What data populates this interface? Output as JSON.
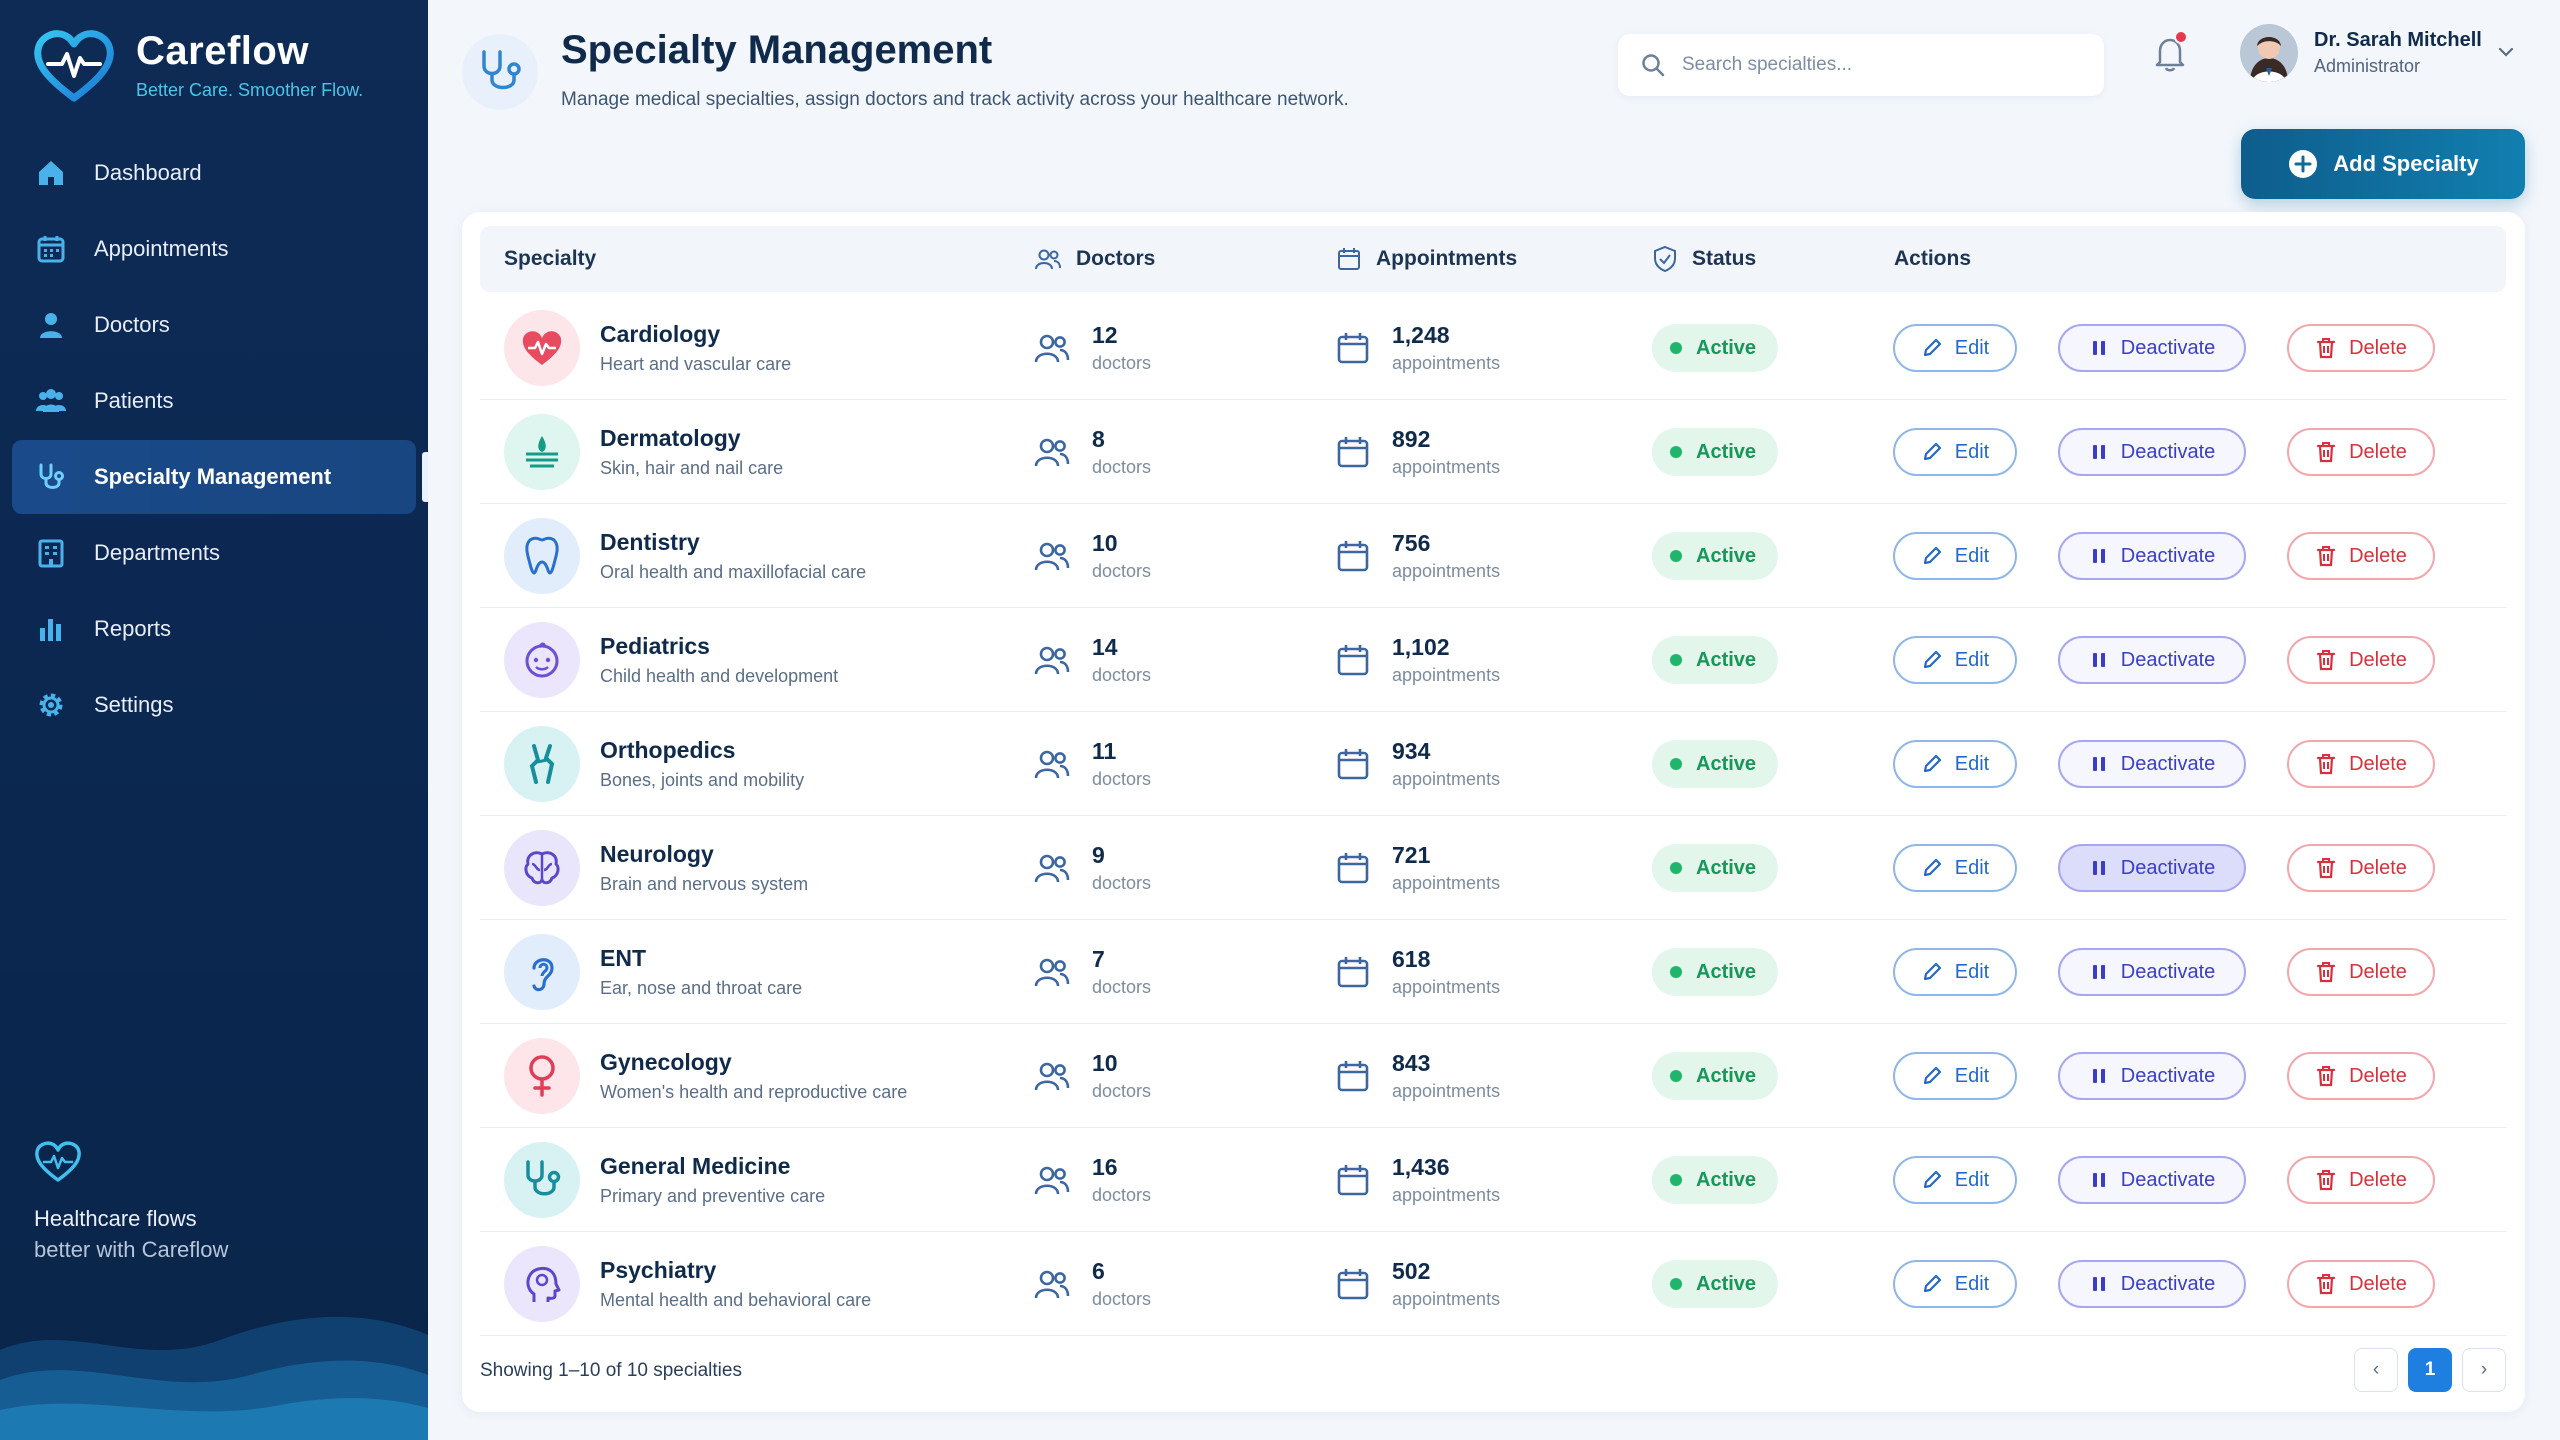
{
  "brand": {
    "name": "Careflow",
    "tagline": "Better Care. Smoother Flow."
  },
  "sidebar": {
    "items": [
      {
        "label": "Dashboard",
        "icon": "home-icon"
      },
      {
        "label": "Appointments",
        "icon": "calendar-icon"
      },
      {
        "label": "Doctors",
        "icon": "person-icon"
      },
      {
        "label": "Patients",
        "icon": "people-icon"
      },
      {
        "label": "Specialty Management",
        "icon": "stethoscope-icon",
        "active": true
      },
      {
        "label": "Departments",
        "icon": "building-icon"
      },
      {
        "label": "Reports",
        "icon": "bar-chart-icon"
      },
      {
        "label": "Settings",
        "icon": "gear-icon"
      }
    ],
    "footer_line1": "Healthcare flows",
    "footer_line2": "better with Careflow"
  },
  "header": {
    "title": "Specialty Management",
    "subtitle": "Manage medical specialties, assign doctors and track activity across your healthcare network.",
    "search_placeholder": "Search specialties...",
    "user_name": "Dr. Sarah Mitchell",
    "user_role": "Administrator",
    "add_label": "Add Specialty"
  },
  "table": {
    "columns": [
      "Specialty",
      "Doctors",
      "Appointments",
      "Status",
      "Actions"
    ],
    "doctors_unit": "doctors",
    "appointments_unit": "appointments",
    "actions": {
      "edit": "Edit",
      "deactivate": "Deactivate",
      "delete": "Delete"
    },
    "rows": [
      {
        "name": "Cardiology",
        "desc": "Heart and vascular care",
        "doctors": "12",
        "appointments": "1,248",
        "status": "Active",
        "icon": "heart-pulse-icon"
      },
      {
        "name": "Dermatology",
        "desc": "Skin, hair and nail care",
        "doctors": "8",
        "appointments": "892",
        "status": "Active",
        "icon": "skin-layers-icon"
      },
      {
        "name": "Dentistry",
        "desc": "Oral health and maxillofacial care",
        "doctors": "10",
        "appointments": "756",
        "status": "Active",
        "icon": "tooth-icon"
      },
      {
        "name": "Pediatrics",
        "desc": "Child health and development",
        "doctors": "14",
        "appointments": "1,102",
        "status": "Active",
        "icon": "baby-face-icon"
      },
      {
        "name": "Orthopedics",
        "desc": "Bones, joints and mobility",
        "doctors": "11",
        "appointments": "934",
        "status": "Active",
        "icon": "bone-joint-icon"
      },
      {
        "name": "Neurology",
        "desc": "Brain and nervous system",
        "doctors": "9",
        "appointments": "721",
        "status": "Active",
        "icon": "brain-icon"
      },
      {
        "name": "ENT",
        "desc": "Ear, nose and throat care",
        "doctors": "7",
        "appointments": "618",
        "status": "Active",
        "icon": "ear-icon"
      },
      {
        "name": "Gynecology",
        "desc": "Women's health and reproductive care",
        "doctors": "10",
        "appointments": "843",
        "status": "Active",
        "icon": "female-symbol-icon"
      },
      {
        "name": "General Medicine",
        "desc": "Primary and preventive care",
        "doctors": "16",
        "appointments": "1,436",
        "status": "Active",
        "icon": "stethoscope-icon"
      },
      {
        "name": "Psychiatry",
        "desc": "Mental health and behavioral care",
        "doctors": "6",
        "appointments": "502",
        "status": "Active",
        "icon": "head-mind-icon"
      }
    ]
  },
  "footer": {
    "showing": "Showing 1–10 of 10 specialties",
    "current_page": "1",
    "prev": "‹",
    "next": "›"
  },
  "colors": {
    "sidebar_bg": "#0d2b55",
    "accent": "#1f7fe0",
    "add_button": "#0e5d8c",
    "status_active": "#18965a",
    "edit": "#2469c8",
    "deactivate": "#3a3ec4",
    "delete": "#d7313f"
  }
}
